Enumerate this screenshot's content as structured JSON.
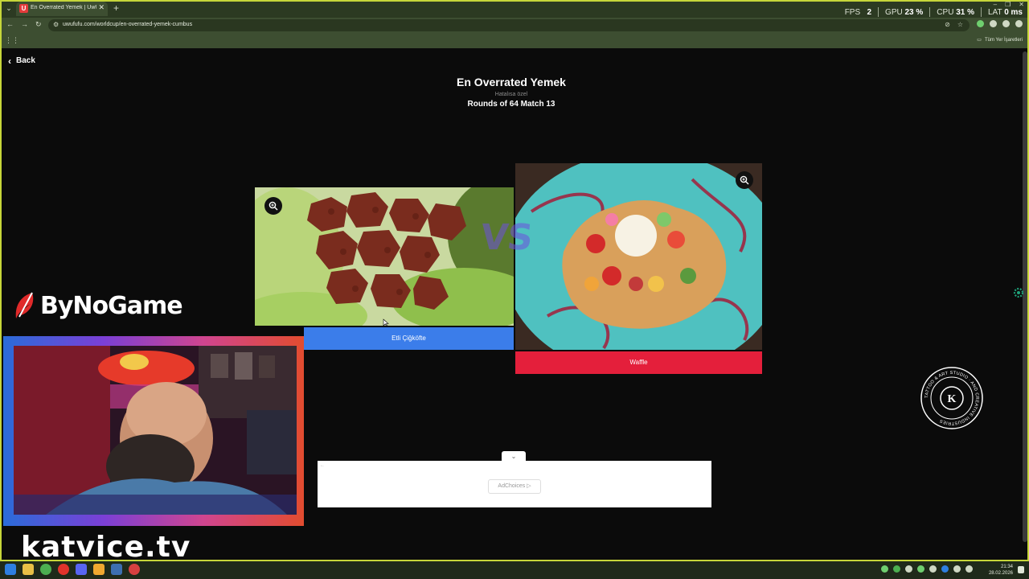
{
  "browser": {
    "tab_title": "En Overrated Yemek | UwUFUFU",
    "favicon_letter": "U",
    "url": "uwufufu.com/worldcup/en-overrated-yemek-cumbus",
    "bookmarks_all": "Tüm Yer İşaretleri"
  },
  "perf": {
    "fps_label": "FPS",
    "fps_value": "2",
    "gpu_label": "GPU",
    "gpu_value": "23 %",
    "cpu_label": "CPU",
    "cpu_value": "31 %",
    "lat_label": "LAT",
    "lat_value": "0 ms"
  },
  "page": {
    "back_label": "Back",
    "title": "En Overrated Yemek",
    "subtitle": "Hatalısa özel",
    "round_label": "Rounds of 64 Match 13",
    "vs": "VS"
  },
  "candidates": [
    {
      "name": "Etli Çiğköfte",
      "color": "#3b7dea"
    },
    {
      "name": "Waffle",
      "color": "#e41f3b"
    }
  ],
  "ad": {
    "choices_label": "AdChoices"
  },
  "overlay": {
    "logo_text": "ByNoGame",
    "watermark": "katvice.tv",
    "stamp_text": "TATTOO & ART STUDIO · AND CREATIVE INDUSTRIES",
    "stamp_letter": "K"
  },
  "taskbar": {
    "time": "21:34",
    "date": "28.02.2026"
  }
}
